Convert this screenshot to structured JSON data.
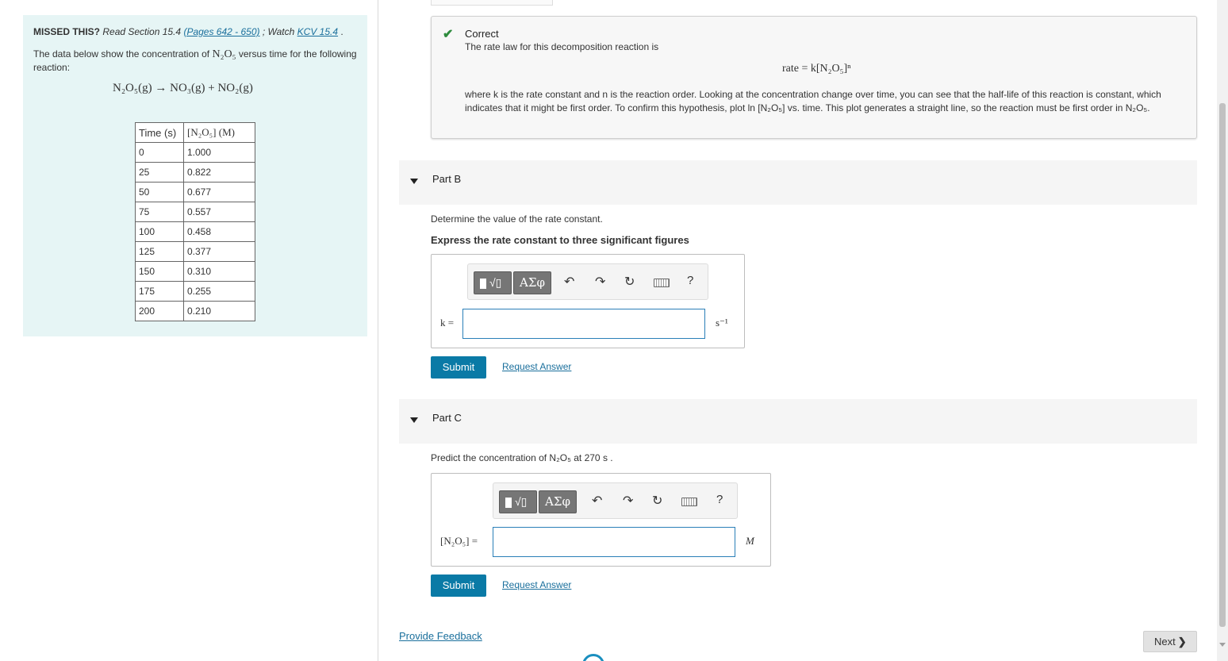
{
  "left": {
    "missed_bold": "MISSED THIS?",
    "missed_read": "Read Section 15.4",
    "missed_pages": "(Pages 642 - 650)",
    "missed_watch": "; Watch",
    "missed_kcv": "KCV 15.4",
    "missed_end": ".",
    "intro_pre": "The data below show the concentration of",
    "intro_species": "N₂O₅",
    "intro_post": "versus time for the following reaction:",
    "reaction": "N₂O₅(g) → NO₃(g) + NO₂(g)",
    "table": {
      "headers": [
        "Time (s)",
        "[N₂O₅] (M)"
      ],
      "rows": [
        [
          "0",
          "1.000"
        ],
        [
          "25",
          "0.822"
        ],
        [
          "50",
          "0.677"
        ],
        [
          "75",
          "0.557"
        ],
        [
          "100",
          "0.458"
        ],
        [
          "125",
          "0.377"
        ],
        [
          "150",
          "0.310"
        ],
        [
          "175",
          "0.255"
        ],
        [
          "200",
          "0.210"
        ]
      ]
    }
  },
  "correct": {
    "title": "Correct",
    "line1": "The rate law for this decomposition reaction is",
    "equation": "rate = k[N₂O₅]ⁿ",
    "para": "where k is the rate constant and n is the reaction order. Looking at the concentration change over time, you can see that the half-life of this reaction is constant, which indicates that it might be first order. To confirm this hypothesis, plot ln [N₂O₅] vs. time. This plot generates a straight line, so the reaction must be first order in N₂O₅."
  },
  "partB": {
    "title": "Part B",
    "question": "Determine the value of the rate constant.",
    "instruction": "Express the rate constant to three significant figures",
    "label": "k =",
    "unit": "s⁻¹",
    "input_value": "",
    "submit": "Submit",
    "request": "Request Answer"
  },
  "partC": {
    "title": "Part C",
    "question": "Predict the concentration of N₂O₅ at 270 s .",
    "label": "[N₂O₅] =",
    "unit": "M",
    "input_value": "",
    "submit": "Submit",
    "request": "Request Answer"
  },
  "toolbar": {
    "greek": "ΑΣφ",
    "sqrt": "√▯",
    "help": "?",
    "icons": [
      "undo-icon",
      "redo-icon",
      "reset-icon",
      "keyboard-icon",
      "help-icon"
    ]
  },
  "footer": {
    "feedback": "Provide Feedback",
    "next": "Next"
  },
  "colors": {
    "left_panel_bg": "#e6f5f5",
    "check_green": "#2e8b3d",
    "submit_blue": "#0a7aa6",
    "link_blue": "#1a6f9c",
    "input_border": "#2a7fb8"
  }
}
